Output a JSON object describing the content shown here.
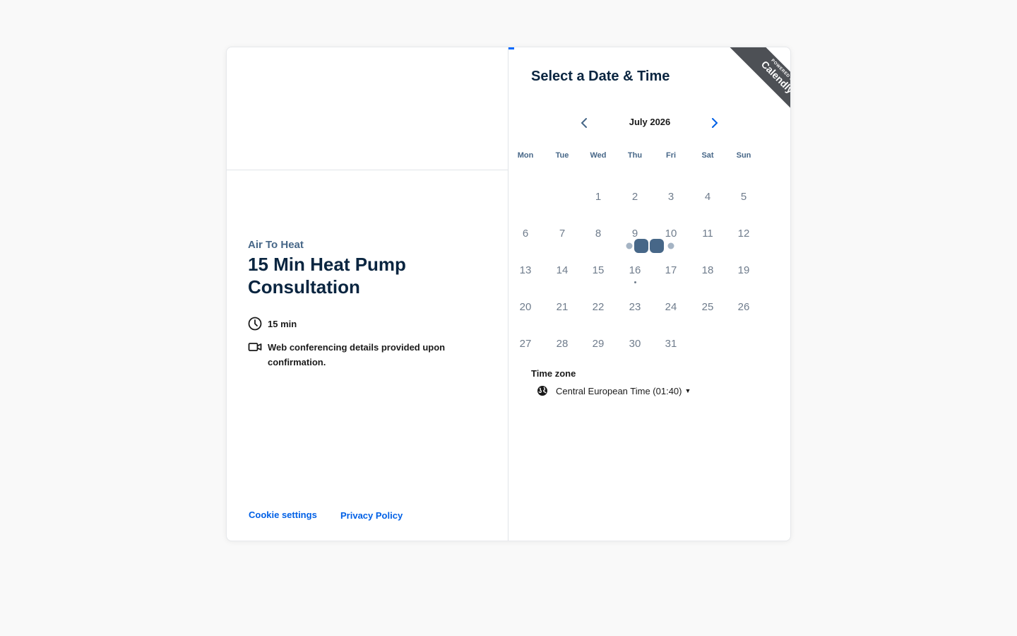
{
  "event": {
    "organizer": "Air To Heat",
    "title": "15 Min Heat Pump Consultation",
    "duration": "15 min",
    "location": "Web conferencing details provided upon confirmation."
  },
  "footer": {
    "cookie_settings": "Cookie settings",
    "privacy_policy": "Privacy Policy"
  },
  "scheduler": {
    "heading": "Select a Date & Time",
    "badge_small": "POWERED BY",
    "badge_brand": "Calendly",
    "month_label": "July 2026",
    "weekdays": [
      "Mon",
      "Tue",
      "Wed",
      "Thu",
      "Fri",
      "Sat",
      "Sun"
    ],
    "first_weekday_index": 2,
    "days_in_month": 31,
    "today": 16,
    "timezone_label": "Time zone",
    "timezone_value": "Central European Time (01:40)"
  },
  "colors": {
    "accent": "#0069ff",
    "link": "#0060e6",
    "heading": "#0a2540",
    "badge": "#4d5055"
  }
}
